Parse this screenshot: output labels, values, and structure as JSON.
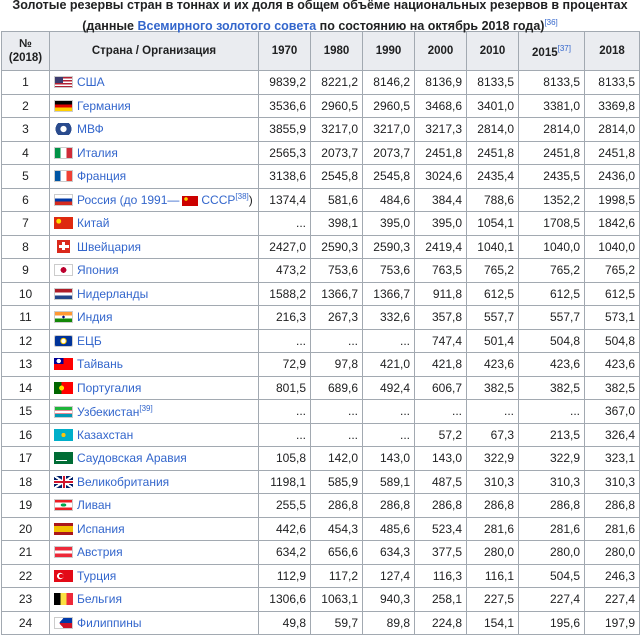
{
  "caption": {
    "line1": "Золотые резервы стран в тоннах и их доля в общем объёме национальных резервов в процентах",
    "prefix": "(данные ",
    "link": "Всемирного золотого совета",
    "suffix": " по состоянию на октябрь 2018 года)",
    "ref": "[36]"
  },
  "headers": {
    "rank_line1": "№",
    "rank_line2": "(2018)",
    "country": "Страна / Организация",
    "y1970": "1970",
    "y1980": "1980",
    "y1990": "1990",
    "y2000": "2000",
    "y2010": "2010",
    "y2015": "2015",
    "y2015_ref": "[37]",
    "y2018": "2018"
  },
  "rows": [
    {
      "rank": "1",
      "name": "США",
      "flag": "usa-flag-icon",
      "v": [
        "9839,2",
        "8221,2",
        "8146,2",
        "8136,9",
        "8133,5",
        "8133,5",
        "8133,5"
      ]
    },
    {
      "rank": "2",
      "name": "Германия",
      "flag": "germany-flag-icon",
      "v": [
        "3536,6",
        "2960,5",
        "2960,5",
        "3468,6",
        "3401,0",
        "3381,0",
        "3369,8"
      ]
    },
    {
      "rank": "3",
      "name": "МВФ",
      "flag": "imf-seal-icon",
      "v": [
        "3855,9",
        "3217,0",
        "3217,0",
        "3217,3",
        "2814,0",
        "2814,0",
        "2814,0"
      ]
    },
    {
      "rank": "4",
      "name": "Италия",
      "flag": "italy-flag-icon",
      "v": [
        "2565,3",
        "2073,7",
        "2073,7",
        "2451,8",
        "2451,8",
        "2451,8",
        "2451,8"
      ]
    },
    {
      "rank": "5",
      "name": "Франция",
      "flag": "france-flag-icon",
      "v": [
        "3138,6",
        "2545,8",
        "2545,8",
        "3024,6",
        "2435,4",
        "2435,5",
        "2436,0"
      ]
    },
    {
      "rank": "6",
      "name": "Россия (до 1991—",
      "name2": "СССР",
      "ref": "[38]",
      "suffix": ")",
      "flag": "russia-flag-icon",
      "flag2": "ussr-flag-icon",
      "v": [
        "1374,4",
        "581,6",
        "484,6",
        "384,4",
        "788,6",
        "1352,2",
        "1998,5"
      ]
    },
    {
      "rank": "7",
      "name": "Китай",
      "flag": "china-flag-icon",
      "v": [
        "...",
        "398,1",
        "395,0",
        "395,0",
        "1054,1",
        "1708,5",
        "1842,6"
      ]
    },
    {
      "rank": "8",
      "name": "Швейцария",
      "flag": "switzerland-flag-icon",
      "v": [
        "2427,0",
        "2590,3",
        "2590,3",
        "2419,4",
        "1040,1",
        "1040,0",
        "1040,0"
      ]
    },
    {
      "rank": "9",
      "name": "Япония",
      "flag": "japan-flag-icon",
      "v": [
        "473,2",
        "753,6",
        "753,6",
        "763,5",
        "765,2",
        "765,2",
        "765,2"
      ]
    },
    {
      "rank": "10",
      "name": "Нидерланды",
      "flag": "netherlands-flag-icon",
      "v": [
        "1588,2",
        "1366,7",
        "1366,7",
        "911,8",
        "612,5",
        "612,5",
        "612,5"
      ]
    },
    {
      "rank": "11",
      "name": "Индия",
      "flag": "india-flag-icon",
      "v": [
        "216,3",
        "267,3",
        "332,6",
        "357,8",
        "557,7",
        "557,7",
        "573,1"
      ]
    },
    {
      "rank": "12",
      "name": "ЕЦБ",
      "flag": "ecb-logo-icon",
      "v": [
        "...",
        "...",
        "...",
        "747,4",
        "501,4",
        "504,8",
        "504,8"
      ]
    },
    {
      "rank": "13",
      "name": "Тайвань",
      "flag": "taiwan-flag-icon",
      "v": [
        "72,9",
        "97,8",
        "421,0",
        "421,8",
        "423,6",
        "423,6",
        "423,6"
      ]
    },
    {
      "rank": "14",
      "name": "Португалия",
      "flag": "portugal-flag-icon",
      "v": [
        "801,5",
        "689,6",
        "492,4",
        "606,7",
        "382,5",
        "382,5",
        "382,5"
      ]
    },
    {
      "rank": "15",
      "name": "Узбекистан",
      "ref": "[39]",
      "flag": "uzbekistan-flag-icon",
      "v": [
        "...",
        "...",
        "...",
        "...",
        "...",
        "...",
        "367,0"
      ]
    },
    {
      "rank": "16",
      "name": "Казахстан",
      "flag": "kazakhstan-flag-icon",
      "v": [
        "...",
        "...",
        "...",
        "57,2",
        "67,3",
        "213,5",
        "326,4"
      ]
    },
    {
      "rank": "17",
      "name": "Саудовская Аравия",
      "flag": "saudi-arabia-flag-icon",
      "v": [
        "105,8",
        "142,0",
        "143,0",
        "143,0",
        "322,9",
        "322,9",
        "323,1"
      ]
    },
    {
      "rank": "18",
      "name": "Великобритания",
      "flag": "uk-flag-icon",
      "v": [
        "1198,1",
        "585,9",
        "589,1",
        "487,5",
        "310,3",
        "310,3",
        "310,3"
      ]
    },
    {
      "rank": "19",
      "name": "Ливан",
      "flag": "lebanon-flag-icon",
      "v": [
        "255,5",
        "286,8",
        "286,8",
        "286,8",
        "286,8",
        "286,8",
        "286,8"
      ]
    },
    {
      "rank": "20",
      "name": "Испания",
      "flag": "spain-flag-icon",
      "v": [
        "442,6",
        "454,3",
        "485,6",
        "523,4",
        "281,6",
        "281,6",
        "281,6"
      ]
    },
    {
      "rank": "21",
      "name": "Австрия",
      "flag": "austria-flag-icon",
      "v": [
        "634,2",
        "656,6",
        "634,3",
        "377,5",
        "280,0",
        "280,0",
        "280,0"
      ]
    },
    {
      "rank": "22",
      "name": "Турция",
      "flag": "turkey-flag-icon",
      "v": [
        "112,9",
        "117,2",
        "127,4",
        "116,3",
        "116,1",
        "504,5",
        "246,3"
      ]
    },
    {
      "rank": "23",
      "name": "Бельгия",
      "flag": "belgium-flag-icon",
      "v": [
        "1306,6",
        "1063,1",
        "940,3",
        "258,1",
        "227,5",
        "227,4",
        "227,4"
      ]
    },
    {
      "rank": "24",
      "name": "Филиппины",
      "flag": "philippines-flag-icon",
      "v": [
        "49,8",
        "59,7",
        "89,8",
        "224,8",
        "154,1",
        "195,6",
        "197,9"
      ]
    }
  ]
}
